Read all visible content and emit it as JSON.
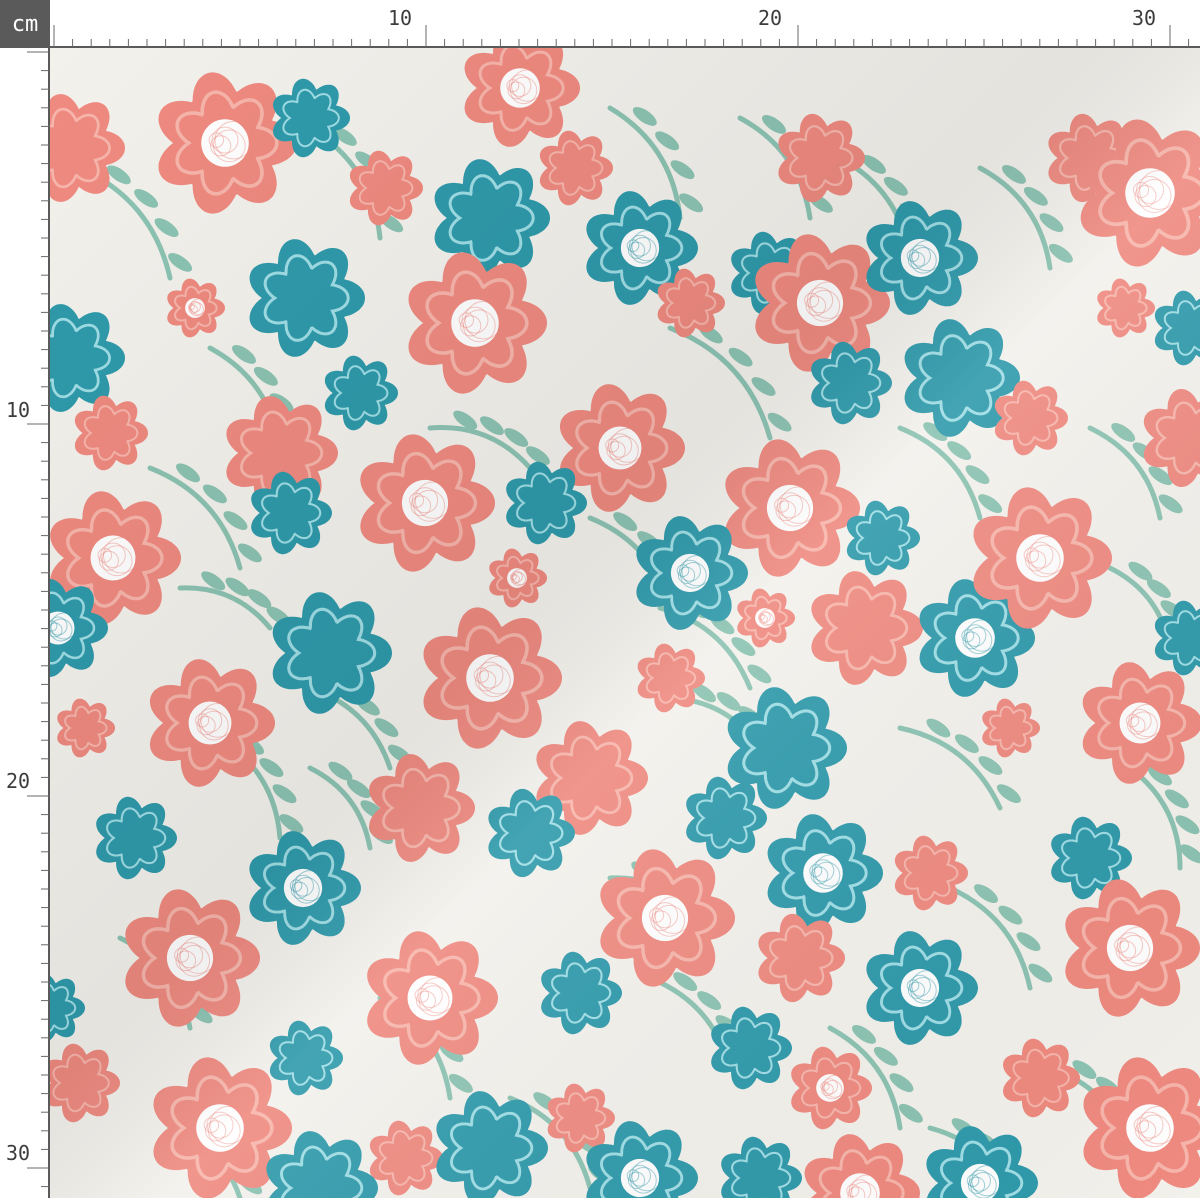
{
  "ruler": {
    "unit": "cm",
    "top_labels": [
      "10",
      "20",
      "30"
    ],
    "left_labels": [
      "10",
      "20",
      "30"
    ]
  },
  "fabric": {
    "background_color": "#f3f1ec",
    "pattern": "floral",
    "colors": {
      "coral": "#ef8a80",
      "coral_light": "#f7b5ab",
      "teal": "#2f9aab",
      "teal_light": "#9fdde5",
      "leaf": "#8cc3b2",
      "center": "#ffffff"
    }
  }
}
